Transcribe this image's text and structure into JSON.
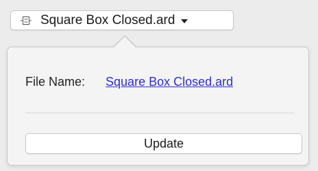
{
  "toolbar": {
    "document_button_label": "Square Box Closed.ard",
    "document_icon": "document-proxy-icon",
    "menu_icon": "chevron-down-icon"
  },
  "popover": {
    "file_name_label": "File Name:",
    "file_name_value": "Square Box Closed.ard",
    "update_button_label": "Update"
  },
  "colors": {
    "link": "#2f2fcf",
    "background": "#ececec",
    "popover_background": "#f4f4f4"
  }
}
